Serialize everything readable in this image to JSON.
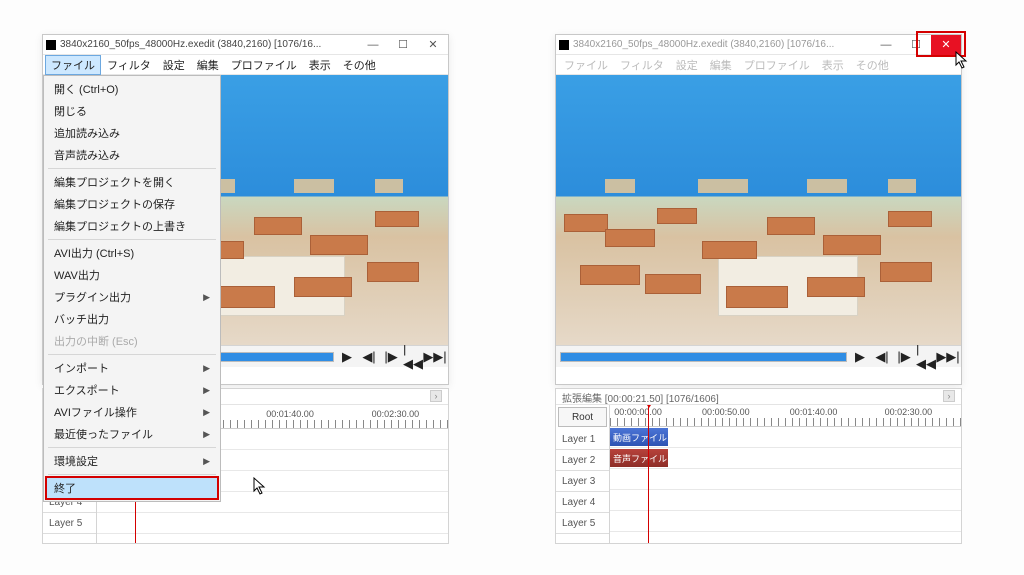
{
  "window": {
    "title": "3840x2160_50fps_48000Hz.exedit (3840,2160)  [1076/16..."
  },
  "menubar": {
    "items": [
      "ファイル",
      "フィルタ",
      "設定",
      "編集",
      "プロファイル",
      "表示",
      "その他"
    ],
    "active_index": 0
  },
  "file_menu": {
    "open": "開く (Ctrl+O)",
    "close": "閉じる",
    "append": "追加読み込み",
    "audio_load": "音声読み込み",
    "open_project": "編集プロジェクトを開く",
    "save_project": "編集プロジェクトの保存",
    "overwrite_project": "編集プロジェクトの上書き",
    "avi_out": "AVI出力 (Ctrl+S)",
    "wav_out": "WAV出力",
    "plugin_out": "プラグイン出力",
    "batch_out": "バッチ出力",
    "abort_out": "出力の中断 (Esc)",
    "import": "インポート",
    "export": "エクスポート",
    "avi_ops": "AVIファイル操作",
    "recent": "最近使ったファイル",
    "env": "環境設定",
    "exit": "終了"
  },
  "timeline": {
    "title": "拡張編集 [00:00:21.50] [1076/1606]",
    "root": "Root",
    "times": [
      "00:00:00.00",
      "00:00:50.00",
      "00:01:40.00",
      "00:02:30.00"
    ],
    "layers": [
      "Layer 1",
      "Layer 2",
      "Layer 3",
      "Layer 4",
      "Layer 5"
    ],
    "video_clip": "動画ファイル",
    "audio_clip": "音声ファイル"
  },
  "player": {
    "play": "▶",
    "prev_frame": "◀|",
    "next_frame": "|▶",
    "to_start": "|◀◀",
    "to_end": "▶▶|"
  },
  "winctrl": {
    "min": "—",
    "max": "☐",
    "close": "✕"
  }
}
